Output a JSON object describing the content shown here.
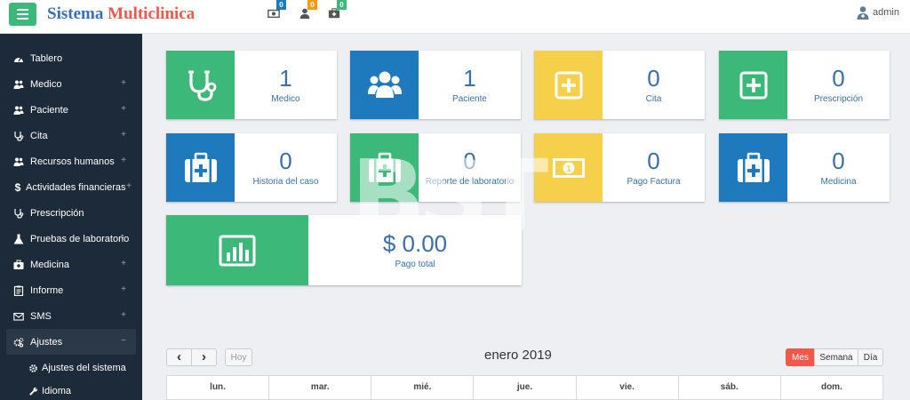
{
  "brand": {
    "part1": "Sistema",
    "part2": "Multiclinica"
  },
  "notifications": [
    {
      "icon": "money-icon",
      "count": "0",
      "color": "#1e79bd"
    },
    {
      "icon": "user-icon",
      "count": "0",
      "color": "#f39c12"
    },
    {
      "icon": "medkit-icon",
      "count": "0",
      "color": "#3cb878"
    }
  ],
  "user": {
    "name": "admin"
  },
  "sidebar": {
    "items": [
      {
        "label": "Tablero",
        "icon": "dashboard-icon",
        "expandable": false
      },
      {
        "label": "Medico",
        "icon": "users-icon",
        "expandable": true,
        "toggle": "+"
      },
      {
        "label": "Paciente",
        "icon": "users-icon",
        "expandable": true,
        "toggle": "+"
      },
      {
        "label": "Cita",
        "icon": "stethoscope-icon",
        "expandable": true,
        "toggle": "+"
      },
      {
        "label": "Recursos humanos",
        "icon": "users-icon",
        "expandable": true,
        "toggle": "+"
      },
      {
        "label": "Actividades financieras",
        "icon": "dollar-icon",
        "expandable": true,
        "toggle": "+"
      },
      {
        "label": "Prescripción",
        "icon": "stethoscope-icon",
        "expandable": false
      },
      {
        "label": "Pruebas de laboratorio",
        "icon": "flask-icon",
        "expandable": true,
        "toggle": "+"
      },
      {
        "label": "Medicina",
        "icon": "medkit-icon",
        "expandable": true,
        "toggle": "+"
      },
      {
        "label": "Informe",
        "icon": "clipboard-icon",
        "expandable": true,
        "toggle": "+"
      },
      {
        "label": "SMS",
        "icon": "envelope-icon",
        "expandable": true,
        "toggle": "+"
      },
      {
        "label": "Ajustes",
        "icon": "cogs-icon",
        "expandable": true,
        "toggle": "−",
        "active": true
      }
    ],
    "subitems": [
      {
        "label": "Ajustes del sistema",
        "icon": "cog-icon"
      },
      {
        "label": "Idioma",
        "icon": "wrench-icon"
      }
    ]
  },
  "cards": [
    {
      "value": "1",
      "label": "Medico",
      "icon": "stethoscope-icon",
      "color": "#3cb878"
    },
    {
      "value": "1",
      "label": "Paciente",
      "icon": "users-icon",
      "color": "#1e79bd"
    },
    {
      "value": "0",
      "label": "Cita",
      "icon": "plus-square-icon",
      "color": "#f7d04b"
    },
    {
      "value": "0",
      "label": "Prescripción",
      "icon": "plus-square-icon",
      "color": "#3cb878"
    },
    {
      "value": "0",
      "label": "Historia del caso",
      "icon": "medkit-icon",
      "color": "#1e79bd"
    },
    {
      "value": "0",
      "label": "Reporte de laboratorio",
      "icon": "medkit-icon",
      "color": "#3cb878"
    },
    {
      "value": "0",
      "label": "Pago Factura",
      "icon": "money-icon",
      "color": "#f7d04b"
    },
    {
      "value": "0",
      "label": "Medicina",
      "icon": "medkit-icon",
      "color": "#1e79bd"
    }
  ],
  "total": {
    "value": "$ 0.00",
    "label": "Pago total",
    "icon": "bar-chart-icon",
    "color": "#3cb878"
  },
  "calendar": {
    "title": "enero 2019",
    "prev": "‹",
    "next": "›",
    "today": "Hoy",
    "views": [
      {
        "label": "Mes",
        "active": true
      },
      {
        "label": "Semana"
      },
      {
        "label": "Día"
      }
    ],
    "days": [
      "lun.",
      "mar.",
      "mié.",
      "jue.",
      "vie.",
      "sáb.",
      "dom."
    ]
  }
}
